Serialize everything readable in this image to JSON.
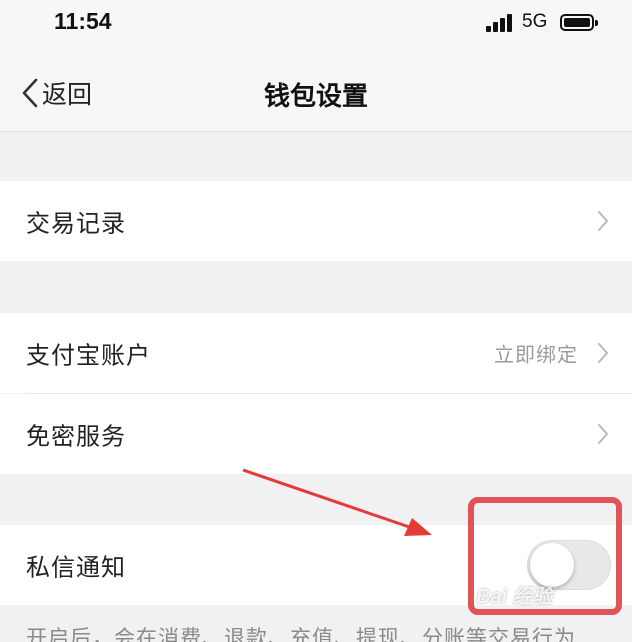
{
  "status_bar": {
    "time": "11:54",
    "network": "5G",
    "icons": [
      "signal-icon",
      "battery-icon"
    ]
  },
  "nav": {
    "back_label": "返回",
    "title": "钱包设置",
    "back_icon": "chevron-left-icon"
  },
  "rows": {
    "transactions": {
      "label": "交易记录"
    },
    "alipay": {
      "label": "支付宝账户",
      "value": "立即绑定"
    },
    "password_free": {
      "label": "免密服务"
    },
    "dm_notify": {
      "label": "私信通知",
      "toggle_on": false
    }
  },
  "footnote": "开启后，会在消费、退款、充值、提现、分账等交易行为",
  "watermark": "Bai 经验",
  "colors": {
    "background": "#f1f1f3",
    "highlight": "#e25357",
    "arrow": "#e53a3a"
  }
}
